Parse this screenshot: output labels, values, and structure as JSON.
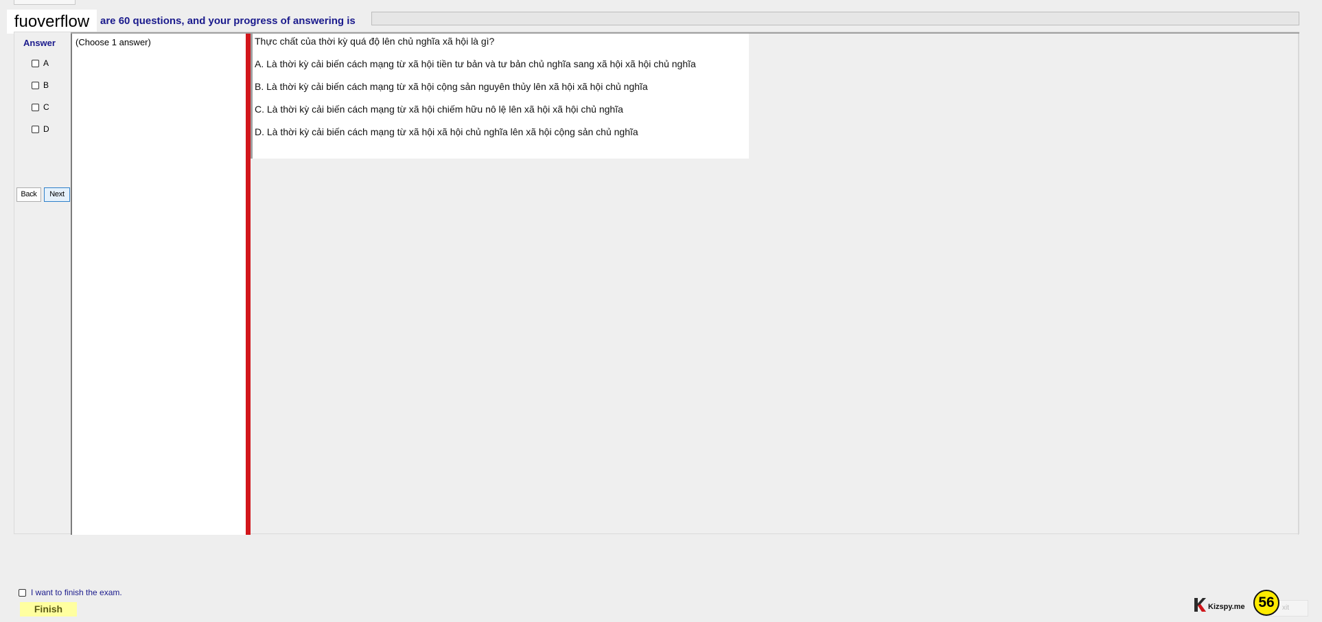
{
  "logo": {
    "text": "fuoverflow"
  },
  "progress": {
    "label": "are 60 questions, and your progress of answering is",
    "fill_fraction": 0
  },
  "answer": {
    "title": "Answer",
    "options": [
      "A",
      "B",
      "C",
      "D"
    ]
  },
  "nav": {
    "back": "Back",
    "next": "Next"
  },
  "instruction": "(Choose 1 answer)",
  "question": {
    "text": "Thực chất của thời kỳ quá độ lên chủ nghĩa xã hội là gì?",
    "choices": [
      "A.  Là thời kỳ cải biến cách mạng từ xã hội tiền tư bản và tư bản chủ nghĩa sang xã hội xã hội chủ nghĩa",
      "B.  Là thời kỳ cải biến cách mạng từ xã hội cộng sản nguyên thủy lên xã hội xã hội chủ nghĩa",
      "C.  Là thời kỳ cải biến cách mạng từ xã hội chiếm hữu nô lệ lên xã hội xã hội chủ nghĩa",
      "D.  Là thời kỳ cải biến cách mạng từ xã hội xã hội chủ nghĩa lên xã hội cộng sản chủ nghĩa"
    ]
  },
  "finish": {
    "checkbox_label": "I want to finish the exam.",
    "button": "Finish"
  },
  "exit": {
    "label": "xit"
  },
  "brand": {
    "name": "Kizspy.me"
  },
  "timer": {
    "value": "56"
  },
  "colors": {
    "accent_text": "#1a1a8c",
    "divider_red": "#d2161b",
    "finish_bg": "#ffffa0",
    "timer_bg": "#ffeb00"
  }
}
